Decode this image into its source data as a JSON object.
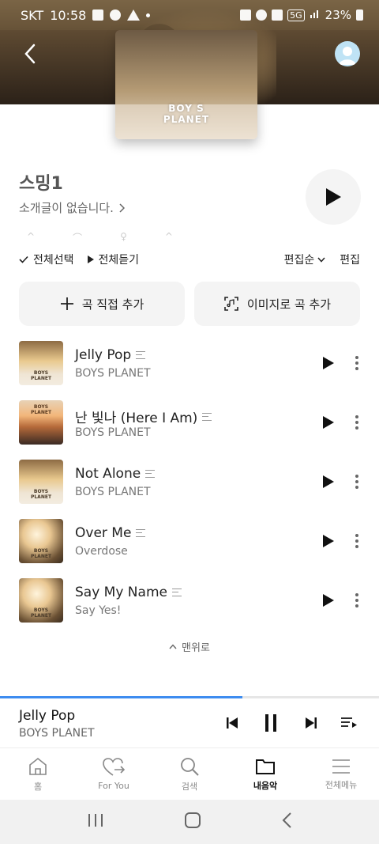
{
  "status_bar": {
    "carrier": "SKT",
    "time": "10:58",
    "battery": "23%",
    "signal_label": "5G"
  },
  "header": {
    "cover_logo_line1": "BOY S",
    "cover_logo_line2": "PLANET"
  },
  "playlist": {
    "title": "스밍1",
    "description": "소개글이 없습니다.",
    "select_all": "전체선택",
    "play_all": "전체듣기",
    "sort": "편집순",
    "edit": "편집",
    "add_direct": "곡 직접 추가",
    "add_image": "이미지로 곡 추가"
  },
  "songs": [
    {
      "title": "Jelly Pop",
      "artist": "BOYS PLANET"
    },
    {
      "title": "난 빛나 (Here I Am)",
      "artist": "BOYS PLANET"
    },
    {
      "title": "Not Alone",
      "artist": "BOYS PLANET"
    },
    {
      "title": "Over Me",
      "artist": "Overdose"
    },
    {
      "title": "Say My Name",
      "artist": "Say Yes!"
    }
  ],
  "thumb_logo": {
    "line1": "BOYS",
    "line2": "PLANET"
  },
  "to_top": "맨위로",
  "mini_player": {
    "title": "Jelly Pop",
    "artist": "BOYS PLANET",
    "progress": 0.64
  },
  "bottom_nav": [
    {
      "label": "홈",
      "icon": "home-icon"
    },
    {
      "label": "For You",
      "icon": "heart-arrow-icon"
    },
    {
      "label": "검색",
      "icon": "search-icon"
    },
    {
      "label": "내음악",
      "icon": "folder-icon"
    },
    {
      "label": "전체메뉴",
      "icon": "menu-icon"
    }
  ],
  "colors": {
    "accent": "#3d8cf0",
    "button_bg": "#f4f4f4"
  }
}
